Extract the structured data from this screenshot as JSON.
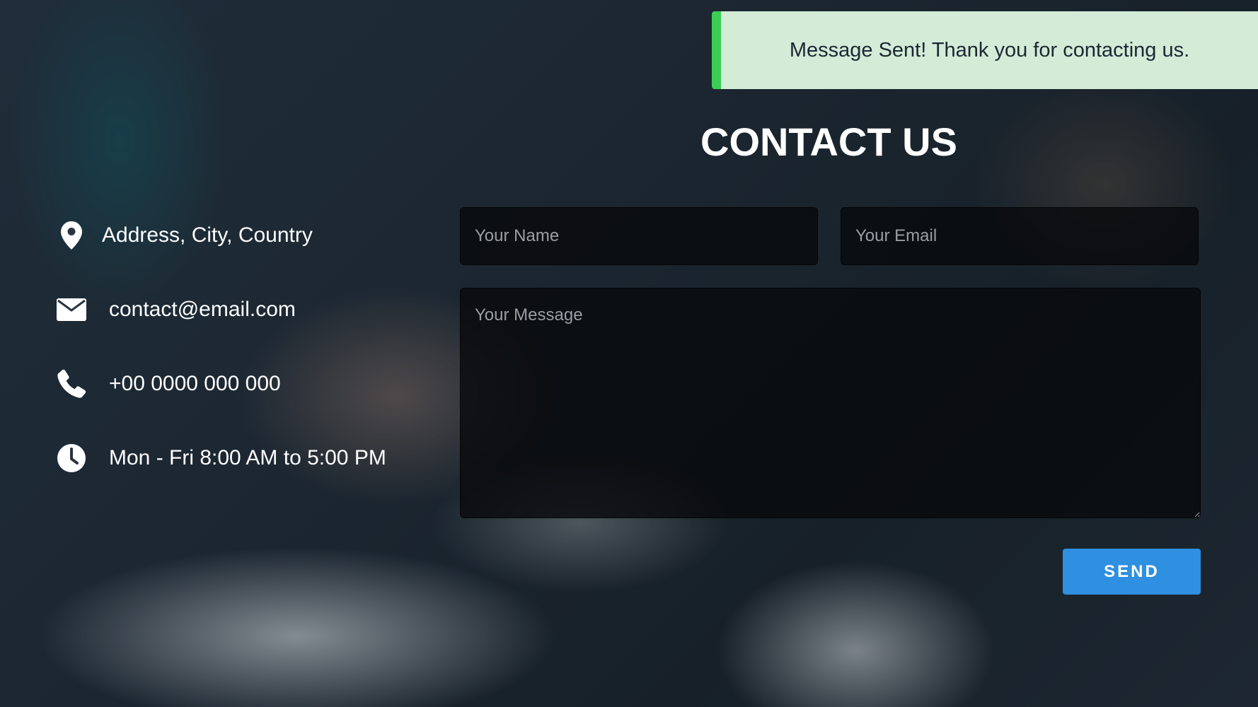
{
  "notification": {
    "message": "Message Sent! Thank you for contacting us."
  },
  "page_title": "CONTACT US",
  "contact_info": [
    {
      "icon": "map-pin-icon",
      "text": "Address, City, Country"
    },
    {
      "icon": "envelope-icon",
      "text": "contact@email.com"
    },
    {
      "icon": "phone-icon",
      "text": "+00 0000 000 000"
    },
    {
      "icon": "clock-icon",
      "text": "Mon - Fri 8:00 AM to 5:00 PM"
    }
  ],
  "form": {
    "name_placeholder": "Your Name",
    "email_placeholder": "Your Email",
    "message_placeholder": "Your Message",
    "send_label": "SEND"
  },
  "colors": {
    "success_accent": "#3ccd55",
    "success_bg": "#d4ecd7",
    "button_blue": "#2f8fe0"
  }
}
